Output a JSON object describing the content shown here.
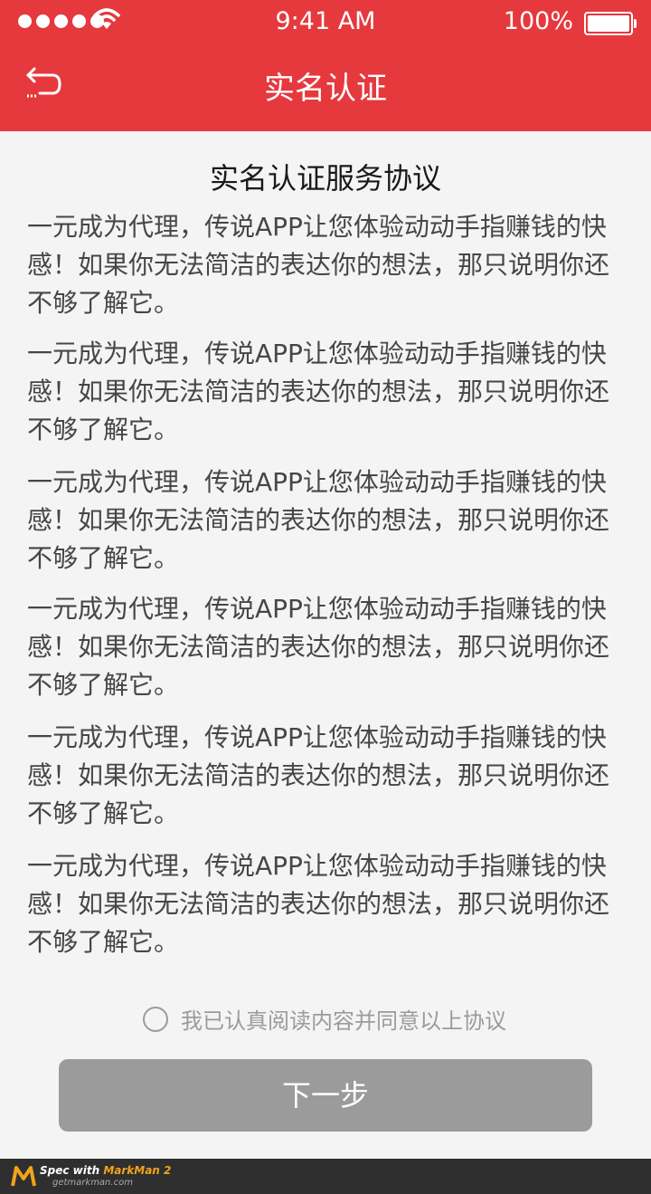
{
  "status_bar": {
    "time": "9:41 AM",
    "battery": "100%"
  },
  "nav": {
    "title": "实名认证"
  },
  "document": {
    "title": "实名认证服务协议",
    "paragraphs": [
      "一元成为代理，传说APP让您体验动动手指赚钱的快感！如果你无法简洁的表达你的想法，那只说明你还不够了解它。",
      "一元成为代理，传说APP让您体验动动手指赚钱的快感！如果你无法简洁的表达你的想法，那只说明你还不够了解它。",
      "一元成为代理，传说APP让您体验动动手指赚钱的快感！如果你无法简洁的表达你的想法，那只说明你还不够了解它。",
      "一元成为代理，传说APP让您体验动动手指赚钱的快感！如果你无法简洁的表达你的想法，那只说明你还不够了解它。",
      "一元成为代理，传说APP让您体验动动手指赚钱的快感！如果你无法简洁的表达你的想法，那只说明你还不够了解它。",
      "一元成为代理，传说APP让您体验动动手指赚钱的快感！如果你无法简洁的表达你的想法，那只说明你还不够了解它。"
    ]
  },
  "agreement": {
    "label": "我已认真阅读内容并同意以上协议"
  },
  "next_button": {
    "label": "下一步"
  },
  "footer": {
    "spec_label": "Spec with",
    "brand": "MarkMan 2",
    "site": "getmarkman.com"
  },
  "colors": {
    "header": "#e5393e",
    "title_text": "#191919",
    "body_text": "#464646",
    "muted": "#9b9b9b"
  }
}
